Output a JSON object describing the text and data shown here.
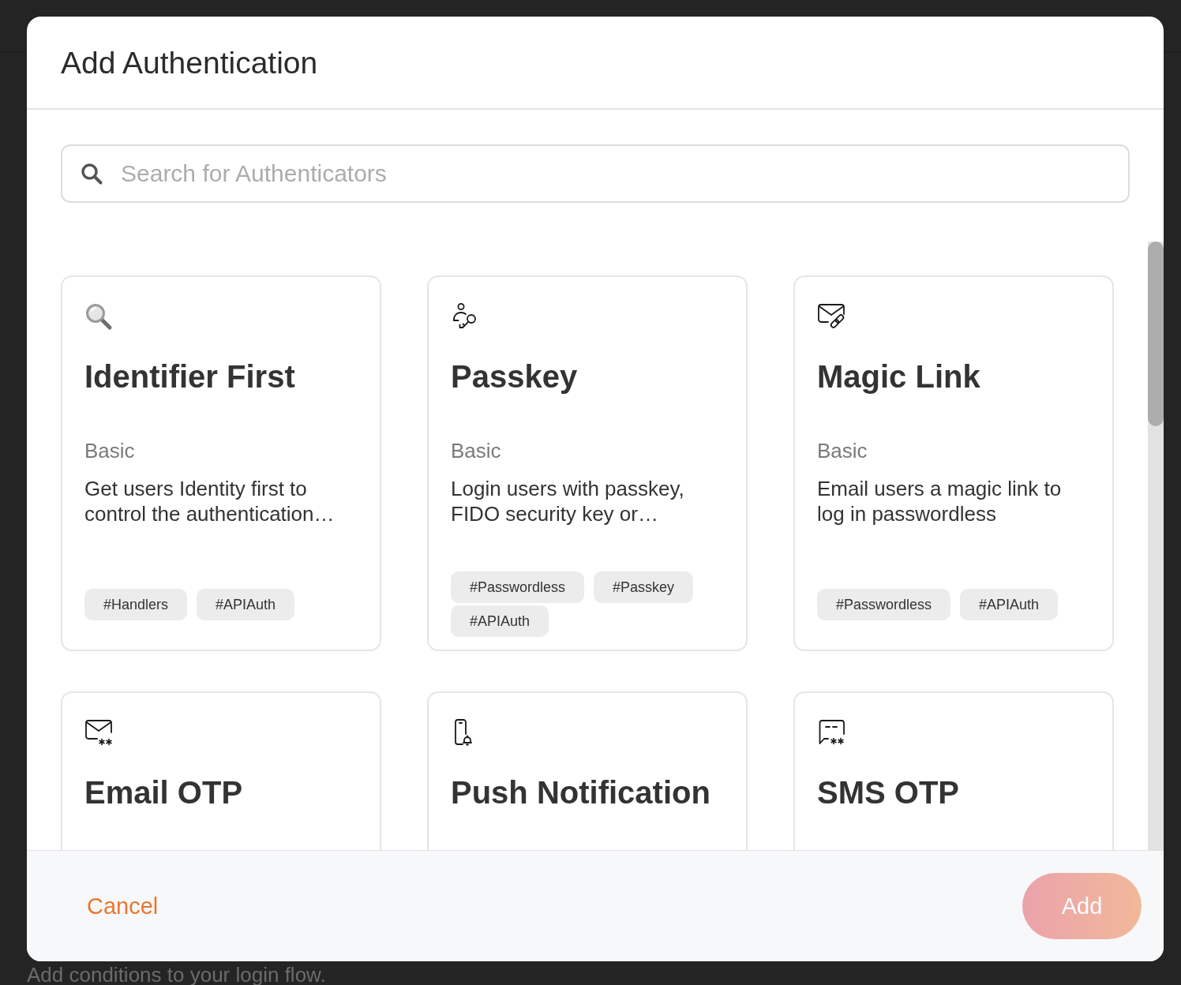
{
  "background_page": {
    "footer_text": "Add conditions to your login flow."
  },
  "dialog": {
    "title": "Add Authentication",
    "search": {
      "placeholder": "Search for Authenticators"
    },
    "cards": [
      {
        "kind": "identifier",
        "title": "Identifier First",
        "category": "Basic",
        "description": "Get users Identity first to control the authentication…",
        "tags": [
          "#Handlers",
          "#APIAuth"
        ]
      },
      {
        "kind": "passkey",
        "title": "Passkey",
        "category": "Basic",
        "description": "Login users with passkey, FIDO security key or…",
        "tags": [
          "#Passwordless",
          "#Passkey",
          "#APIAuth"
        ]
      },
      {
        "kind": "magic_link",
        "title": "Magic Link",
        "category": "Basic",
        "description": "Email users a magic link to log in passwordless",
        "tags": [
          "#Passwordless",
          "#APIAuth"
        ]
      },
      {
        "kind": "email_otp",
        "title": "Email OTP"
      },
      {
        "kind": "push",
        "title": "Push Notification"
      },
      {
        "kind": "sms_otp",
        "title": "SMS OTP"
      }
    ],
    "cancel_button": "Cancel",
    "add_button": {
      "label": "Add",
      "disabled": true
    }
  }
}
